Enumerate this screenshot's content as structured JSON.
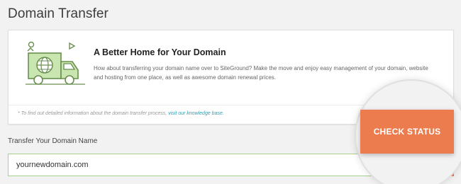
{
  "page": {
    "title": "Domain Transfer"
  },
  "info_card": {
    "heading": "A Better Home for Your Domain",
    "body": "How about transferring your domain name over to SiteGround? Make the move and enjoy easy management of your domain, website and hosting from one place, as well as awesome domain renewal prices.",
    "footnote_prefix": "* To find out detailed information about the domain transfer process, ",
    "footnote_link": "visit our knowledge base",
    "footnote_suffix": ".",
    "illustration_icon": "truck-globe-icon"
  },
  "form": {
    "label": "Transfer Your Domain Name",
    "domain_value": "yournewdomain.com",
    "button_label": "CHECK STATUS"
  },
  "colors": {
    "accent": "#ec7b4d",
    "illustration_fill": "#c9e6b0",
    "illustration_stroke": "#6a8f50",
    "input_border": "#a8d08d",
    "link": "#2a9fb5"
  }
}
